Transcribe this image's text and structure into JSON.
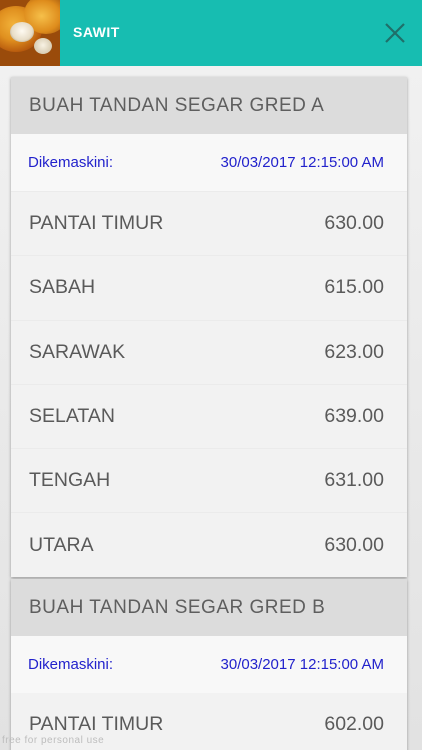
{
  "app": {
    "title": "SAWIT"
  },
  "cards": [
    {
      "title": "BUAH TANDAN SEGAR GRED A",
      "updated_label": "Dikemaskini:",
      "updated_value": "30/03/2017 12:15:00 AM",
      "rows": [
        {
          "region": "PANTAI TIMUR",
          "price": "630.00"
        },
        {
          "region": "SABAH",
          "price": "615.00"
        },
        {
          "region": "SARAWAK",
          "price": "623.00"
        },
        {
          "region": "SELATAN",
          "price": "639.00"
        },
        {
          "region": "TENGAH",
          "price": "631.00"
        },
        {
          "region": "UTARA",
          "price": "630.00"
        }
      ]
    },
    {
      "title": "BUAH TANDAN SEGAR GRED B",
      "updated_label": "Dikemaskini:",
      "updated_value": "30/03/2017 12:15:00 AM",
      "rows": [
        {
          "region": "PANTAI TIMUR",
          "price": "602.00"
        }
      ]
    }
  ],
  "watermark": "free for personal use",
  "icons": {
    "close": "close-icon",
    "thumbnail": "palm-fruit-thumbnail"
  },
  "colors": {
    "accent": "#17bdb1",
    "timestamp": "#2222cc",
    "header_bg": "#dcdcdc"
  }
}
